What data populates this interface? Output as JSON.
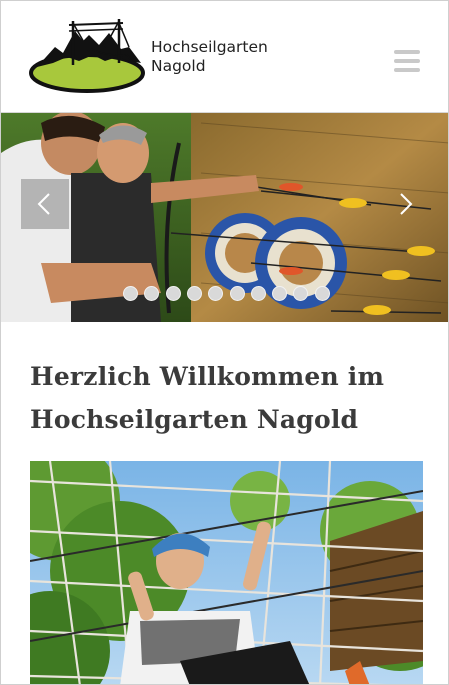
{
  "header": {
    "brand_line1": "Hochseilgarten",
    "brand_line2": "Nagold",
    "logo_icon": "ropes-course-mountain-logo",
    "menu_icon": "hamburger-menu-icon"
  },
  "slider": {
    "slide_count": 10,
    "prev_icon": "chevron-left-icon",
    "next_icon": "chevron-right-icon"
  },
  "content": {
    "heading": "Herzlich Willkommen im Hochseilgarten Nagold"
  },
  "colors": {
    "logo_green": "#a8c83c",
    "text_dark": "#3b3b3b",
    "menu_gray": "#c9c9c9"
  }
}
